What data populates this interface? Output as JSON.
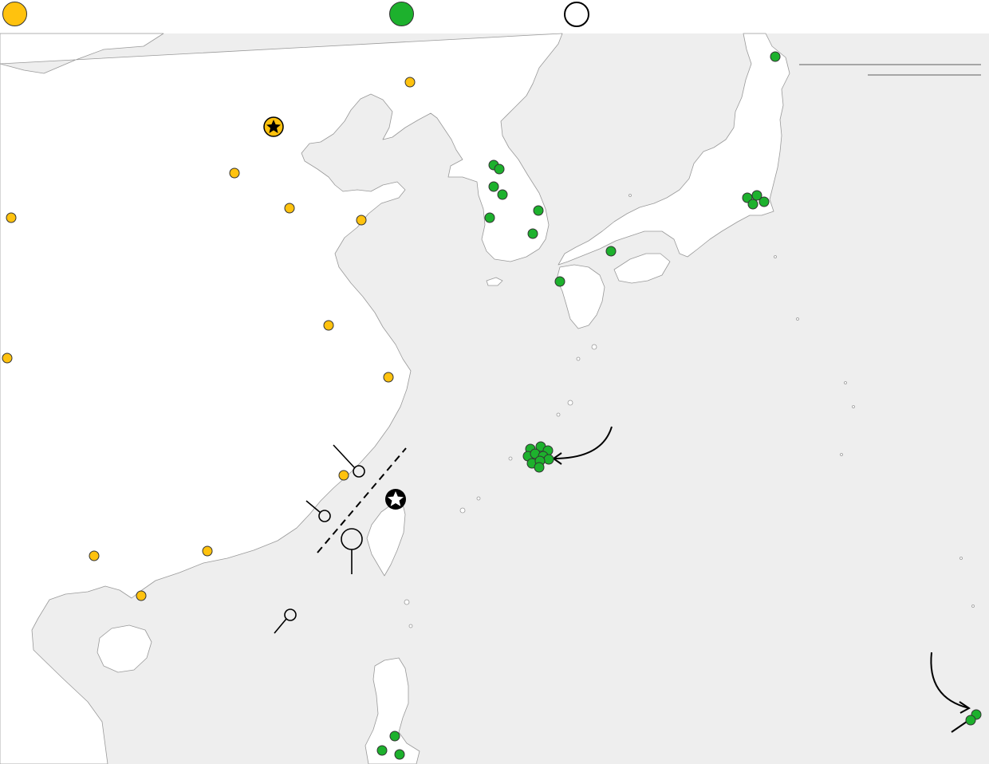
{
  "legend": [
    {
      "category": "china-bases",
      "color": "#FFC20E",
      "label": ""
    },
    {
      "category": "us-allied-bases",
      "color": "#1DB12D",
      "label": ""
    },
    {
      "category": "disputed-islands",
      "color": "#FFFFFF",
      "label": ""
    }
  ],
  "colors": {
    "sea": "#EEEEEE",
    "land": "#FFFFFF",
    "coast": "#999999",
    "stroke": "#000000",
    "rule": "#A6A6A6"
  },
  "markers": {
    "capital_icon": "star-icon",
    "leader_line_icon": "leader-line",
    "taiwan_strait_line": "dashed-line"
  }
}
